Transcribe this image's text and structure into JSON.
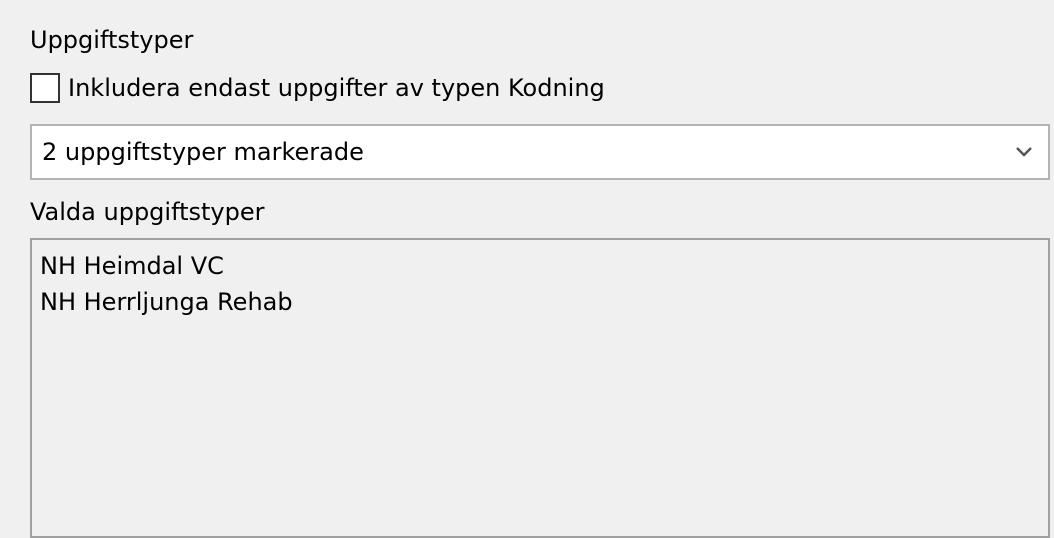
{
  "section": {
    "title": "Uppgiftstyper"
  },
  "checkbox": {
    "label": "Inkludera endast uppgifter av typen Kodning",
    "checked": false
  },
  "dropdown": {
    "value": "2 uppgiftstyper markerade",
    "icon": "chevron-down-icon"
  },
  "selected_list": {
    "title": "Valda uppgiftstyper",
    "items": [
      {
        "label": "NH Heimdal VC"
      },
      {
        "label": "NH Herrljunga Rehab"
      }
    ]
  }
}
